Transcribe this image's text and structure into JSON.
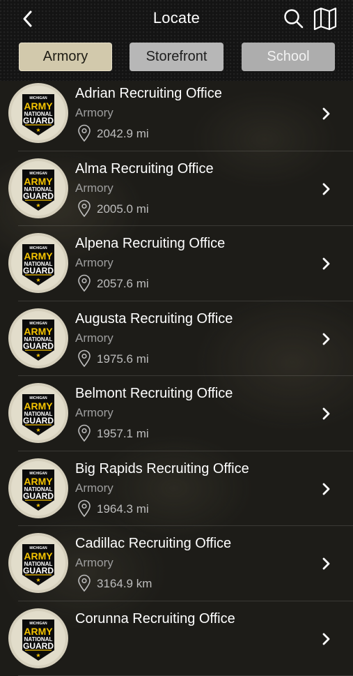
{
  "header": {
    "title": "Locate",
    "back_icon": "chevron-left-icon",
    "search_icon": "search-icon",
    "map_icon": "map-icon"
  },
  "filters": [
    {
      "label": "Armory",
      "selected": true
    },
    {
      "label": "Storefront",
      "selected": false
    },
    {
      "label": "School",
      "selected": false
    }
  ],
  "logo_text": {
    "top": "MICHIGAN",
    "line1": "ARMY",
    "line2": "NATIONAL",
    "line3": "GUARD",
    "star": "★"
  },
  "locations": [
    {
      "name": "Adrian Recruiting Office",
      "type": "Armory",
      "distance": "2042.9 mi"
    },
    {
      "name": "Alma Recruiting Office",
      "type": "Armory",
      "distance": "2005.0 mi"
    },
    {
      "name": "Alpena Recruiting Office",
      "type": "Armory",
      "distance": "2057.6 mi"
    },
    {
      "name": "Augusta Recruiting Office",
      "type": "Armory",
      "distance": "1975.6 mi"
    },
    {
      "name": "Belmont Recruiting Office",
      "type": "Armory",
      "distance": "1957.1 mi"
    },
    {
      "name": "Big Rapids Recruiting Office",
      "type": "Armory",
      "distance": "1964.3 mi"
    },
    {
      "name": "Cadillac Recruiting Office",
      "type": "Armory",
      "distance": "3164.9 km"
    },
    {
      "name": "Corunna Recruiting Office",
      "type": "",
      "distance": ""
    }
  ],
  "colors": {
    "accent": "#d2c9ac",
    "badge_gold": "#f5c400",
    "background": "#1d1c18"
  }
}
